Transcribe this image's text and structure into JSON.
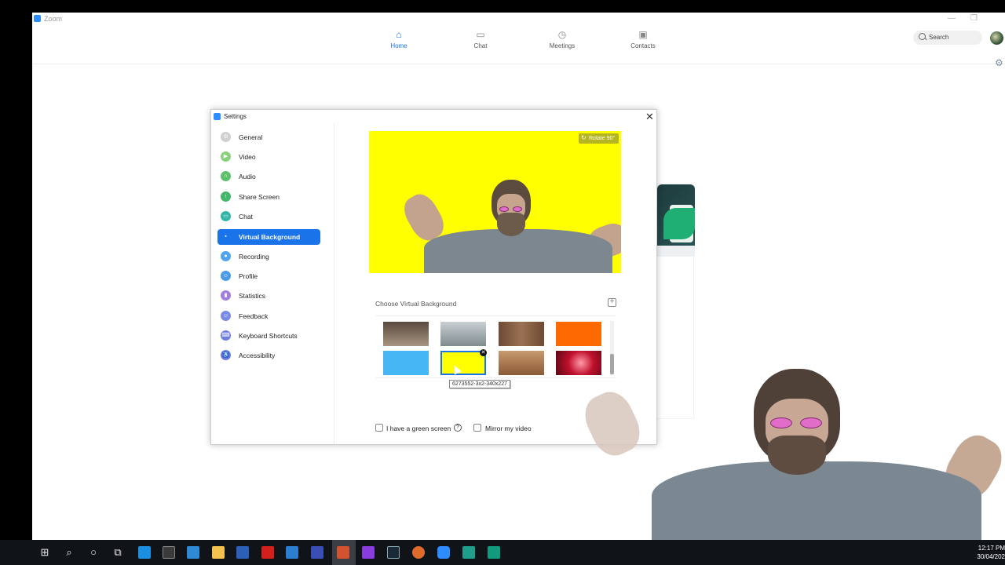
{
  "app": {
    "title": "Zoom",
    "nav": [
      {
        "label": "Home",
        "icon": "home-icon",
        "active": true
      },
      {
        "label": "Chat",
        "icon": "chat-icon",
        "active": false
      },
      {
        "label": "Meetings",
        "icon": "clock-icon",
        "active": false
      },
      {
        "label": "Contacts",
        "icon": "contacts-icon",
        "active": false
      }
    ],
    "search_label": "Search",
    "accent_color": "#1a73e8"
  },
  "settings": {
    "title": "Settings",
    "sidebar": [
      {
        "label": "General",
        "icon": "gear-icon",
        "color": "#cfcfcf"
      },
      {
        "label": "Video",
        "icon": "video-icon",
        "color": "#8bd17c"
      },
      {
        "label": "Audio",
        "icon": "headphones-icon",
        "color": "#5dc16b"
      },
      {
        "label": "Share Screen",
        "icon": "share-screen-icon",
        "color": "#44b86a"
      },
      {
        "label": "Chat",
        "icon": "chat-icon",
        "color": "#33b5a8"
      },
      {
        "label": "Virtual Background",
        "icon": "virtual-background-icon",
        "color": "#1a73e8"
      },
      {
        "label": "Recording",
        "icon": "record-icon",
        "color": "#4fa3ef"
      },
      {
        "label": "Profile",
        "icon": "profile-icon",
        "color": "#4a9ae8"
      },
      {
        "label": "Statistics",
        "icon": "statistics-icon",
        "color": "#a17de0"
      },
      {
        "label": "Feedback",
        "icon": "feedback-icon",
        "color": "#7a8be5"
      },
      {
        "label": "Keyboard Shortcuts",
        "icon": "keyboard-icon",
        "color": "#6f7ce0"
      },
      {
        "label": "Accessibility",
        "icon": "accessibility-icon",
        "color": "#6c7bd8"
      }
    ],
    "rotate_label": "Rotate 90°",
    "choose_label": "Choose Virtual Background",
    "backgrounds": [
      {
        "name": "person-photo",
        "color": "#8a7a66"
      },
      {
        "name": "office-room",
        "color": "#aab4b8"
      },
      {
        "name": "wooden-wall",
        "color": "#8b6245"
      },
      {
        "name": "orange",
        "color": "#ff6a00"
      },
      {
        "name": "light-blue",
        "color": "#46b6f4"
      },
      {
        "name": "yellow",
        "color": "#ffff00",
        "selected": true
      },
      {
        "name": "wood-floor",
        "color": "#b07a4f"
      },
      {
        "name": "red-swirl",
        "color": "#b0102a"
      }
    ],
    "tooltip": "6273552-3x2-340x227",
    "green_screen_label": "I have a green screen",
    "mirror_label": "Mirror my video"
  },
  "taskbar": {
    "time": "12:17 PM",
    "date": "30/04/202"
  }
}
